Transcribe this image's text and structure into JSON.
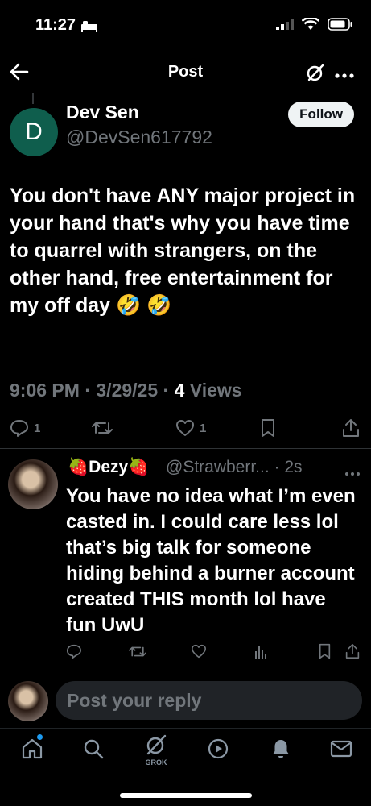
{
  "status": {
    "time": "11:27"
  },
  "header": {
    "title": "Post"
  },
  "tweet": {
    "avatar_letter": "D",
    "name": "Dev Sen",
    "handle": "@DevSen617792",
    "follow_label": "Follow",
    "text": "You don't have ANY major project in your hand that's why you have time to quarrel with strangers, on the other hand, free entertainment for my off day 🤣 🤣",
    "time": "9:06 PM",
    "date": "3/29/25",
    "views_count": "4",
    "views_label": "Views",
    "replies": "1",
    "likes": "1"
  },
  "reply": {
    "name": "🍓Dezy🍓",
    "handle": "@Strawberr...",
    "age": "2s",
    "text": "You have no idea what I’m even casted in. I could care less lol that’s big talk for someone hiding behind a burner account created THIS month lol have fun UwU"
  },
  "composer": {
    "placeholder": "Post your reply"
  },
  "nav": {
    "grok_label": "GROK"
  },
  "colors": {
    "background": "#000000",
    "text": "#e7e9ea",
    "muted": "#71767b",
    "accent": "#1d9bf0",
    "avatar_bg": "#0f5e4d"
  }
}
